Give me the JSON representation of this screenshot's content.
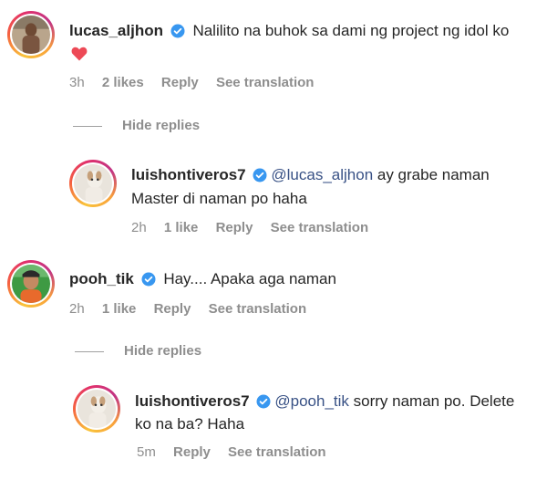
{
  "comments": [
    {
      "username": "lucas_aljhon",
      "text": "Nalilito na buhok sa dami ng project ng idol ko",
      "emoji": "❤️",
      "time": "3h",
      "likes": "2 likes",
      "reply": "Reply",
      "translation": "See translation"
    }
  ],
  "hide_replies_1": "Hide replies",
  "reply1": {
    "username": "luishontiveros7",
    "mention": "@lucas_aljhon",
    "text_a": " ay grabe naman",
    "text_b": "Master di naman po haha",
    "time": "2h",
    "likes": "1 like",
    "reply": "Reply",
    "translation": "See translation"
  },
  "comment2": {
    "username": "pooh_tik",
    "text": "Hay.... Apaka aga naman",
    "time": "2h",
    "likes": "1 like",
    "reply": "Reply",
    "translation": "See translation"
  },
  "hide_replies_2": "Hide replies",
  "reply2": {
    "username": "luishontiveros7",
    "mention": "@pooh_tik",
    "text_a": " sorry naman po. Delete",
    "text_b": "ko na ba? Haha",
    "time": "5m",
    "reply": "Reply",
    "translation": "See translation"
  },
  "colors": {
    "verified": "#3897f0",
    "heart": "#ed4956",
    "meta": "#8e8e8e",
    "mention": "#385185"
  },
  "icons": [
    "verified-badge-icon",
    "heart-emoji-icon"
  ]
}
